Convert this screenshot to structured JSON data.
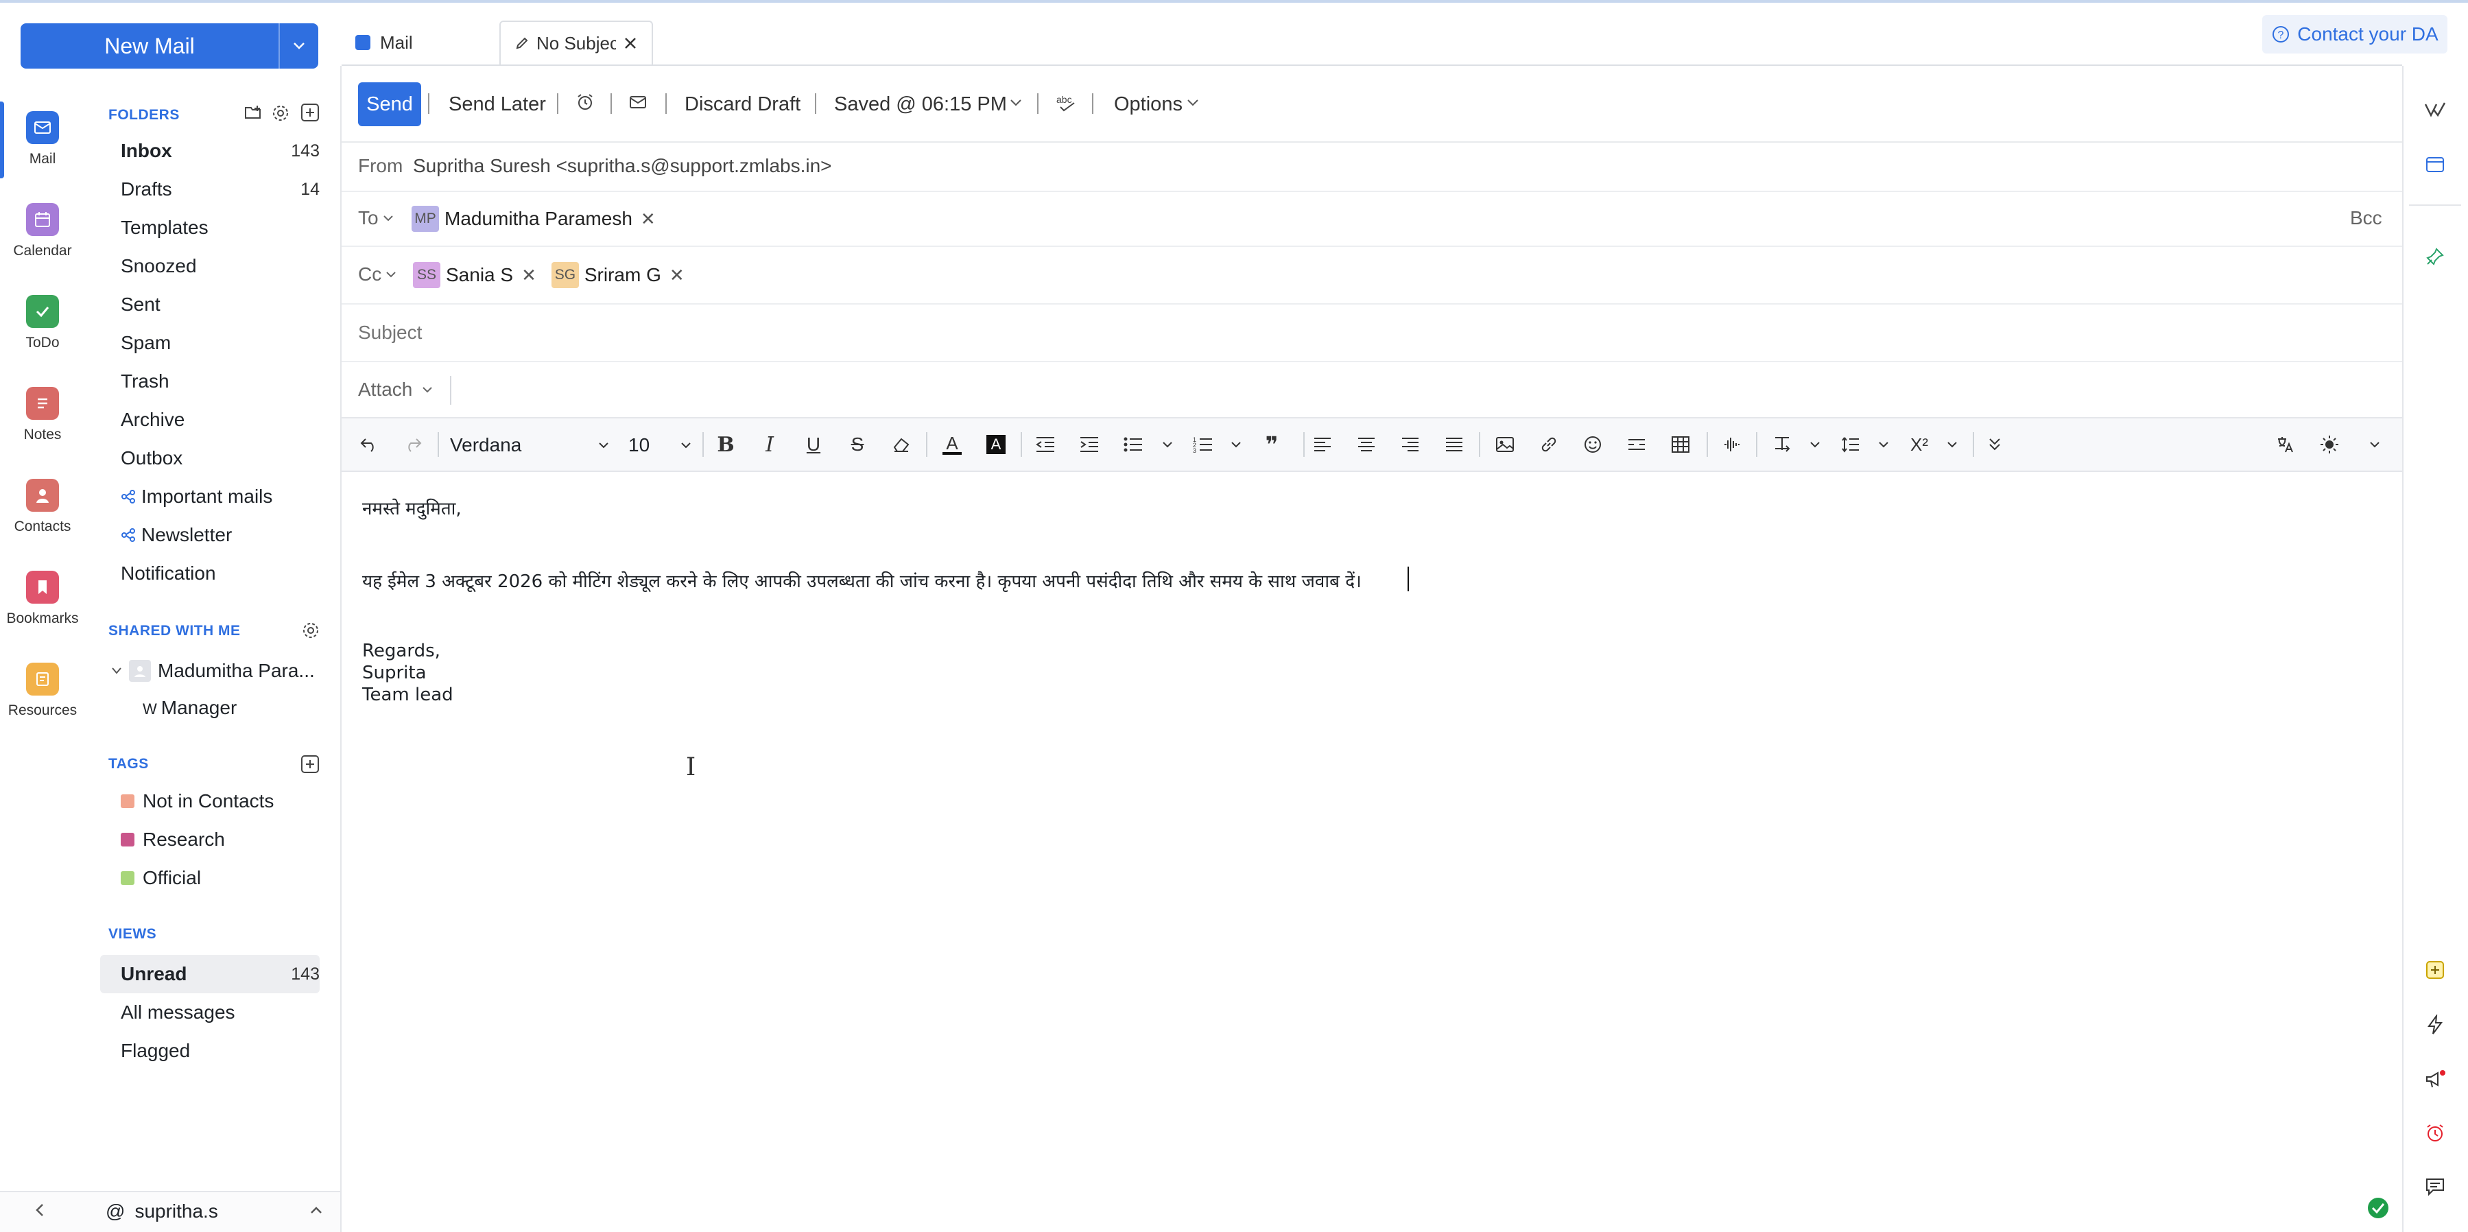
{
  "new_mail": {
    "label": "New Mail"
  },
  "rail": [
    {
      "label": "Mail",
      "icon": "mail-icon",
      "color": "#2f6fe0"
    },
    {
      "label": "Calendar",
      "icon": "calendar-icon",
      "color": "#a67cd8"
    },
    {
      "label": "ToDo",
      "icon": "todo-icon",
      "color": "#3aa55a"
    },
    {
      "label": "Notes",
      "icon": "notes-icon",
      "color": "#d86a66"
    },
    {
      "label": "Contacts",
      "icon": "contacts-icon",
      "color": "#d9716a"
    },
    {
      "label": "Bookmarks",
      "icon": "bookmarks-icon",
      "color": "#e0546d"
    },
    {
      "label": "Resources",
      "icon": "resources-icon",
      "color": "#f2b24a"
    }
  ],
  "folders": {
    "heading": "FOLDERS",
    "items": [
      {
        "label": "Inbox",
        "count": "143"
      },
      {
        "label": "Drafts",
        "count": "14"
      },
      {
        "label": "Templates",
        "count": ""
      },
      {
        "label": "Snoozed",
        "count": ""
      },
      {
        "label": "Sent",
        "count": ""
      },
      {
        "label": "Spam",
        "count": ""
      },
      {
        "label": "Trash",
        "count": ""
      },
      {
        "label": "Archive",
        "count": ""
      },
      {
        "label": "Outbox",
        "count": ""
      },
      {
        "label": "Important mails",
        "count": ""
      },
      {
        "label": "Newsletter",
        "count": ""
      },
      {
        "label": "Notification",
        "count": ""
      }
    ]
  },
  "shared": {
    "heading": "SHARED WITH ME",
    "owner": "Madumitha Para...",
    "child_prefix": "W",
    "child": "Manager"
  },
  "tags": {
    "heading": "TAGS",
    "items": [
      {
        "label": "Not in Contacts",
        "color": "#f2a58e"
      },
      {
        "label": "Research",
        "color": "#c9558a"
      },
      {
        "label": "Official",
        "color": "#a8d67a"
      }
    ]
  },
  "views": {
    "heading": "VIEWS",
    "items": [
      {
        "label": "Unread",
        "count": "143"
      },
      {
        "label": "All messages",
        "count": ""
      },
      {
        "label": "Flagged",
        "count": ""
      }
    ]
  },
  "account": {
    "at": "@",
    "user": "supritha.s"
  },
  "tabs": {
    "mail": "Mail",
    "compose": "No Subjec"
  },
  "contact_da": "Contact your DA",
  "toolbar": {
    "send": "Send",
    "send_later": "Send Later",
    "discard": "Discard Draft",
    "saved": "Saved @ 06:15 PM",
    "options": "Options"
  },
  "fields": {
    "from_label": "From",
    "from_value": "Supritha Suresh <supritha.s@support.zmlabs.in>",
    "to_label": "To",
    "to": [
      {
        "initials": "MP",
        "name": "Madumitha Paramesh",
        "color": "#b8b3e8"
      }
    ],
    "bcc": "Bcc",
    "cc_label": "Cc",
    "cc": [
      {
        "initials": "SS",
        "name": "Sania S",
        "color": "#d7a8e6"
      },
      {
        "initials": "SG",
        "name": "Sriram G",
        "color": "#f6d39b"
      }
    ],
    "subject_placeholder": "Subject",
    "attach": "Attach"
  },
  "editor": {
    "font": "Verdana",
    "size": "10"
  },
  "body": {
    "greeting": "नमस्ते मदुमिता,",
    "line1": "यह ईमेल 3 अक्टूबर 2026 को मीटिंग शेड्यूल करने के लिए आपकी उपलब्धता की जांच करना है। कृपया अपनी पसंदीदा तिथि और समय के साथ जवाब दें।",
    "regards": "Regards,",
    "name": "Suprita",
    "title": "Team lead"
  }
}
